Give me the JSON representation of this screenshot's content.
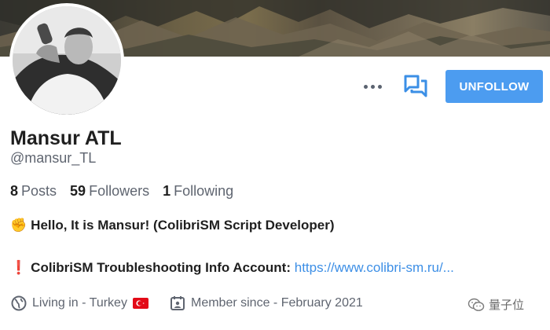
{
  "profile": {
    "name": "Mansur ATL",
    "handle": "@mansur_TL"
  },
  "actions": {
    "more_icon": "more-horizontal-icon",
    "message_icon": "chat-bubbles-icon",
    "unfollow_label": "UNFOLLOW",
    "accent_color": "#4c9cf0"
  },
  "stats": {
    "posts_count": "8",
    "posts_label": "Posts",
    "followers_count": "59",
    "followers_label": "Followers",
    "following_count": "1",
    "following_label": "Following"
  },
  "bio": {
    "line1_emoji": "✊",
    "line1_text": "Hello, It is Mansur! (ColibriSM Script Developer)",
    "line2_emoji": "❗",
    "line2_text": "ColibriSM Troubleshooting Info Account:",
    "line2_link": "https://www.colibri-sm.ru/...",
    "link_color": "#3d8fe6"
  },
  "meta": {
    "location": "Living in - Turkey",
    "location_icon": "globe-icon",
    "flag": "turkey-flag",
    "member_since": "Member since - February 2021",
    "member_icon": "calendar-id-icon"
  },
  "watermark": {
    "text": "量子位",
    "icon": "wechat-icon"
  }
}
